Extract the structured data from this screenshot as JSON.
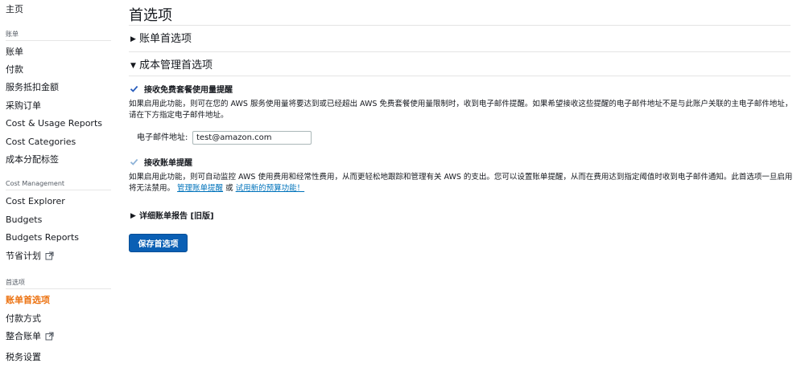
{
  "sidebar": {
    "home": "主页",
    "billing_section": "账单",
    "billing_items": [
      "账单",
      "付款",
      "服务抵扣金额",
      "采购订单",
      "Cost & Usage Reports",
      "Cost Categories",
      "成本分配标签"
    ],
    "cost_mgmt_section": "Cost Management",
    "cost_mgmt_items": [
      "Cost Explorer",
      "Budgets",
      "Budgets Reports",
      "节省计划"
    ],
    "prefs_section": "首选项",
    "prefs_items": [
      "账单首选项",
      "付款方式",
      "整合账单",
      "税务设置"
    ],
    "active_item": "账单首选项",
    "accent_color": "#ec7211"
  },
  "main": {
    "title": "首选项",
    "billing_prefs_toggle": "账单首选项",
    "cost_mgmt_prefs_toggle": "成本管理首选项",
    "free_tier_checkbox": {
      "label": "接收免费套餐使用量提醒",
      "checked": true,
      "description": "如果启用此功能，则可在您的 AWS 服务使用量将要达到或已经超出 AWS 免费套餐使用量限制时，收到电子邮件提醒。如果希望接收这些提醒的电子邮件地址不是与此账户关联的主电子邮件地址，请在下方指定电子邮件地址。"
    },
    "email": {
      "label": "电子邮件地址:",
      "value": "test@amazon.com"
    },
    "billing_alerts_checkbox": {
      "label": "接收账单提醒",
      "checked": true,
      "description": "如果启用此功能，则可自动监控 AWS 使用费用和经常性费用，从而更轻松地跟踪和管理有关 AWS 的支出。您可以设置账单提醒，从而在费用达到指定阈值时收到电子邮件通知。此首选项一旦启用将无法禁用。",
      "link1": "管理账单提醒",
      "or": "或",
      "link2": "试用新的预算功能！"
    },
    "detailed_reports_toggle": "详细账单报告 [旧版]",
    "save_button": "保存首选项"
  }
}
